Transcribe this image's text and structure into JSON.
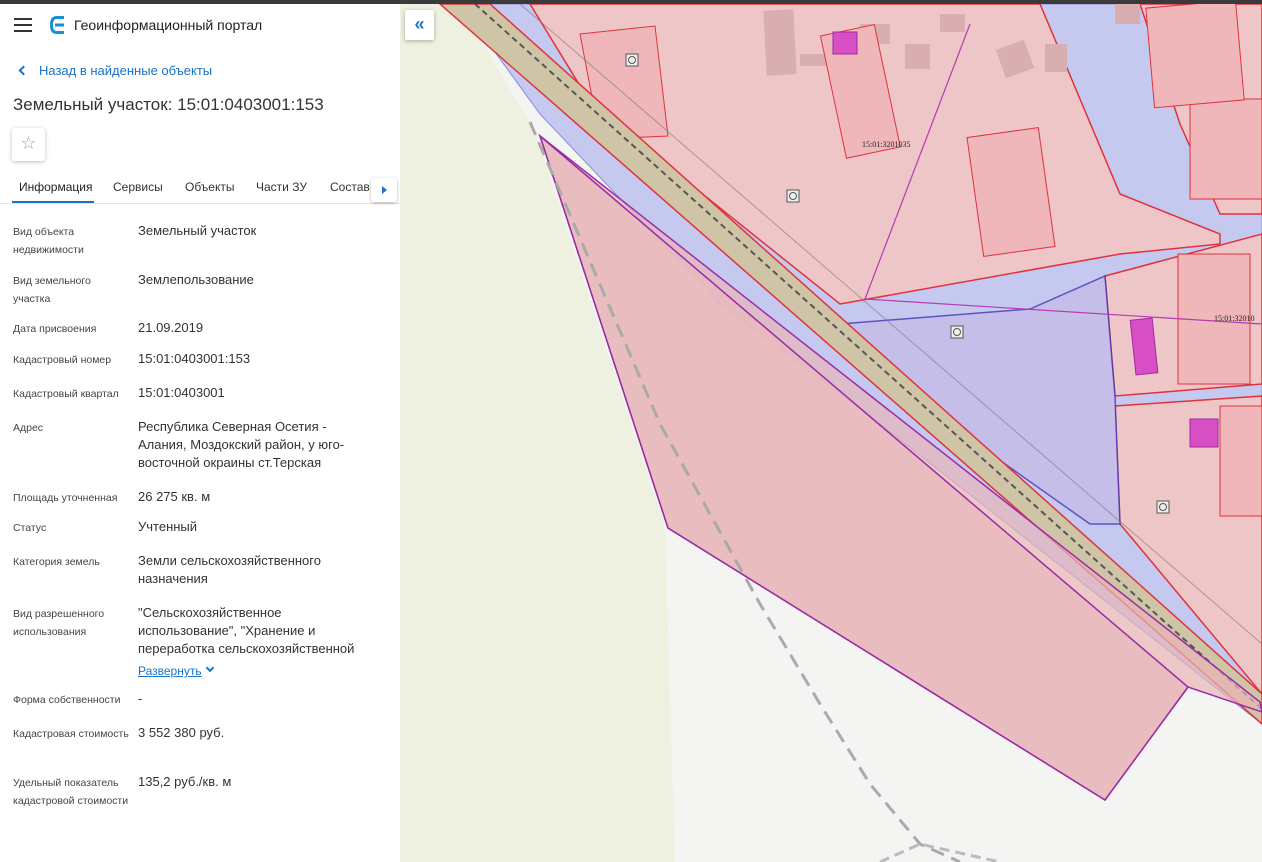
{
  "app": {
    "title": "Геоинформационный портал",
    "menu_icon": "hamburger-menu-icon",
    "logo_icon": "portal-logo-icon"
  },
  "back_link": {
    "label": "Назад в найденные объекты"
  },
  "page_title": "Земельный участок: 15:01:0403001:153",
  "favorite": {
    "icon": "star-outline-icon",
    "glyph": "☆"
  },
  "tabs": [
    {
      "label": "Информация",
      "active": true
    },
    {
      "label": "Сервисы"
    },
    {
      "label": "Объекты"
    },
    {
      "label": "Части ЗУ"
    },
    {
      "label": "Состав"
    }
  ],
  "properties": [
    {
      "label": "Вид объекта недвижимости",
      "value": "Земельный участок"
    },
    {
      "label": "Вид земельного участка",
      "value": "Землепользование"
    },
    {
      "label": "Дата присвоения",
      "value": "21.09.2019"
    },
    {
      "label": "Кадастровый номер",
      "value": "15:01:0403001:153"
    },
    {
      "label": "Кадастровый квартал",
      "value": "15:01:0403001"
    },
    {
      "label": "Адрес",
      "value": "Республика Северная Осетия - Алания, Моздокский район, у юго-восточной окраины ст.Терская"
    },
    {
      "label": "Площадь уточненная",
      "value": "26 275 кв. м"
    },
    {
      "label": "Статус",
      "value": "Учтенный"
    },
    {
      "label": "Категория земель",
      "value": "Земли сельскохозяйственного назначения"
    },
    {
      "label": "Вид разрешенного использования",
      "value": "\"Сельскохозяйственное использование\", \"Хранение и переработка сельскохозяйственной"
    },
    {
      "label": "Форма собственности",
      "value": "-"
    },
    {
      "label": "Кадастровая стоимость",
      "value": "3 552 380 руб."
    },
    {
      "label": "Удельный показатель кадастровой стоимости",
      "value": "135,2 руб./кв. м"
    }
  ],
  "expand_link": {
    "label": "Развернуть"
  },
  "map": {
    "labels": [
      "15:01:3201035",
      "15:01:32010"
    ],
    "collapse_icon": "double-chevron-left-icon",
    "collapse_glyph": "«",
    "colors": {
      "parcel_fill": "#efc6c8",
      "parcel_stroke": "#e0323c",
      "selected_stroke": "#9b2aa8",
      "blue_zone": "#c5c8ef",
      "road": "#cfc4a6",
      "field": "#eef0e0",
      "building": "#d9aeb0",
      "magenta": "#d84fc4"
    }
  }
}
